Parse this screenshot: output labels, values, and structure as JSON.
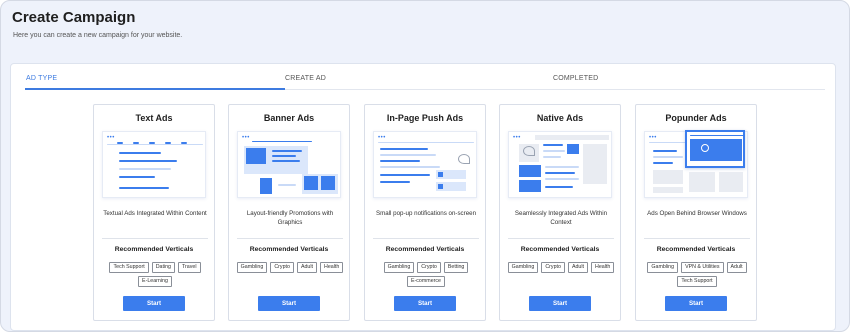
{
  "header": {
    "title": "Create Campaign",
    "subtitle": "Here you can create a new campaign for your website."
  },
  "steps": [
    {
      "label": "AD TYPE",
      "active": true
    },
    {
      "label": "CREATE AD",
      "active": false
    },
    {
      "label": "COMPLETED",
      "active": false
    }
  ],
  "colors": {
    "accent": "#3b7ded",
    "background": "#eef2fb"
  },
  "recommended_label": "Recommended Verticals",
  "start_label": "Start",
  "cards": [
    {
      "title": "Text Ads",
      "description": "Textual Ads Integrated Within Content",
      "tags": [
        "Tech Support",
        "Dating",
        "Travel",
        "E-Learning"
      ],
      "illustration": "text-ads-illustration"
    },
    {
      "title": "Banner Ads",
      "description": "Layout-friendly Promotions with Graphics",
      "tags": [
        "Gambling",
        "Crypto",
        "Adult",
        "Health"
      ],
      "illustration": "banner-ads-illustration"
    },
    {
      "title": "In-Page Push Ads",
      "description": "Small pop-up notifications on-screen",
      "tags": [
        "Gambling",
        "Crypto",
        "Betting",
        "E-commerce"
      ],
      "illustration": "push-ads-illustration"
    },
    {
      "title": "Native Ads",
      "description": "Seamlessly Integrated Ads Within Context",
      "tags": [
        "Gambling",
        "Crypto",
        "Adult",
        "Health"
      ],
      "illustration": "native-ads-illustration"
    },
    {
      "title": "Popunder Ads",
      "description": "Ads Open Behind Browser Windows",
      "tags": [
        "Gambling",
        "VPN & Utilities",
        "Adult",
        "Tech Support"
      ],
      "illustration": "popunder-ads-illustration"
    }
  ]
}
